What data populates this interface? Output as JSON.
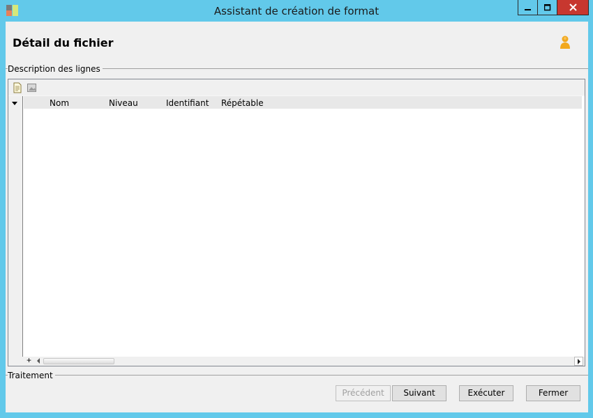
{
  "window": {
    "title": "Assistant de création de format",
    "controls": {
      "minimize": "minimize-icon",
      "maximize": "maximize-icon",
      "close": "close-icon"
    }
  },
  "header": {
    "title": "Détail du fichier",
    "user_icon": "user-icon"
  },
  "groups": {
    "lines_description": "Description des lignes",
    "processing": "Traitement"
  },
  "grid": {
    "toolbar": [
      "new-document-icon",
      "image-icon"
    ],
    "columns": [
      "Nom",
      "Niveau",
      "Identifiant",
      "Répétable"
    ],
    "rows": [],
    "add_row_symbol": "+"
  },
  "buttons": {
    "previous": "Précédent",
    "next": "Suivant",
    "execute": "Exécuter",
    "close": "Fermer"
  },
  "colors": {
    "title_bar": "#62c9ea",
    "close_button": "#c7372f",
    "client_bg": "#f0f0f0"
  }
}
